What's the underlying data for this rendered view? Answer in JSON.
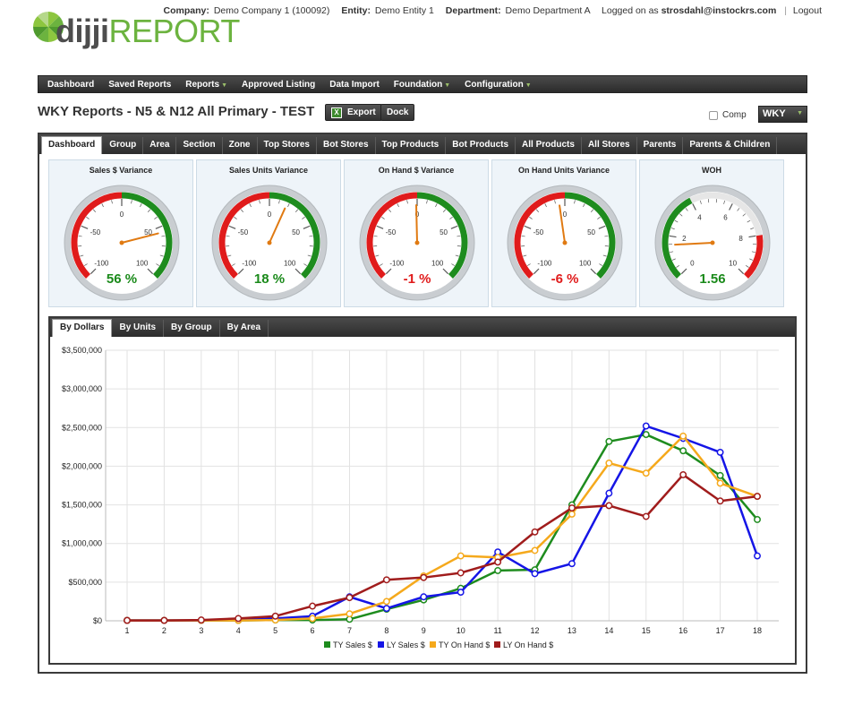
{
  "header": {
    "company_label": "Company:",
    "company_value": "Demo Company 1 (100092)",
    "entity_label": "Entity:",
    "entity_value": "Demo Entity 1",
    "department_label": "Department:",
    "department_value": "Demo Department A",
    "logged_in_prefix": "Logged on as",
    "logged_in_user": "strosdahl@instockrs.com",
    "separator": "|",
    "logout_label": "Logout"
  },
  "logo": {
    "part1": "dijji",
    "part2": "REPORT"
  },
  "nav": [
    {
      "label": "Dashboard",
      "dropdown": false
    },
    {
      "label": "Saved Reports",
      "dropdown": false
    },
    {
      "label": "Reports",
      "dropdown": true
    },
    {
      "label": "Approved Listing",
      "dropdown": false
    },
    {
      "label": "Data Import",
      "dropdown": false
    },
    {
      "label": "Foundation",
      "dropdown": true
    },
    {
      "label": "Configuration",
      "dropdown": true
    }
  ],
  "page": {
    "title": "WKY Reports - N5 & N12 All Primary - TEST",
    "export_label": "Export",
    "dock_label": "Dock",
    "comp_label": "Comp",
    "store_select_value": "WKY"
  },
  "tabs": [
    "Dashboard",
    "Group",
    "Area",
    "Section",
    "Zone",
    "Top Stores",
    "Bot Stores",
    "Top Products",
    "Bot Products",
    "All Products",
    "All Stores",
    "Parents",
    "Parents & Children"
  ],
  "gauges": [
    {
      "title": "Sales $ Variance",
      "value": 56,
      "display": "56 %",
      "color": "#1a8a1a",
      "kind": "variance",
      "ticks": [
        "-100",
        "-50",
        "0",
        "50",
        "100"
      ]
    },
    {
      "title": "Sales Units Variance",
      "value": 18,
      "display": "18 %",
      "color": "#1a8a1a",
      "kind": "variance",
      "ticks": [
        "-100",
        "-50",
        "0",
        "50",
        "100"
      ]
    },
    {
      "title": "On Hand $ Variance",
      "value": -1,
      "display": "-1 %",
      "color": "#e01b1b",
      "kind": "variance",
      "ticks": [
        "-100",
        "-50",
        "0",
        "50",
        "100"
      ]
    },
    {
      "title": "On Hand Units Variance",
      "value": -6,
      "display": "-6 %",
      "color": "#e01b1b",
      "kind": "variance",
      "ticks": [
        "-100",
        "-50",
        "0",
        "50",
        "100"
      ]
    },
    {
      "title": "WOH",
      "value": 1.56,
      "display": "1.56",
      "color": "#1a8a1a",
      "kind": "woh",
      "ticks": [
        "0",
        "2",
        "4",
        "6",
        "8",
        "10"
      ]
    }
  ],
  "chart_tabs": [
    "By Dollars",
    "By Units",
    "By Group",
    "By Area"
  ],
  "chart_data": {
    "type": "line",
    "x": [
      1,
      2,
      3,
      4,
      5,
      6,
      7,
      8,
      9,
      10,
      11,
      12,
      13,
      14,
      15,
      16,
      17,
      18
    ],
    "ylim": [
      0,
      3500000
    ],
    "yticks": [
      "$0",
      "$500,000",
      "$1,000,000",
      "$1,500,000",
      "$2,000,000",
      "$2,500,000",
      "$3,000,000",
      "$3,500,000"
    ],
    "ytick_values": [
      0,
      500000,
      1000000,
      1500000,
      2000000,
      2500000,
      3000000,
      3500000
    ],
    "series": [
      {
        "name": "TY Sales $",
        "color": "#1e8c1e",
        "values": [
          5000,
          5000,
          5000,
          5000,
          10000,
          10000,
          20000,
          150000,
          270000,
          420000,
          650000,
          660000,
          1500000,
          2320000,
          2410000,
          2200000,
          1880000,
          1310000
        ]
      },
      {
        "name": "LY Sales $",
        "color": "#1515e6",
        "values": [
          5000,
          5000,
          5000,
          10000,
          30000,
          60000,
          310000,
          160000,
          310000,
          370000,
          890000,
          610000,
          740000,
          1650000,
          2520000,
          2360000,
          2180000,
          840000
        ]
      },
      {
        "name": "TY On Hand $",
        "color": "#f5a91c",
        "values": [
          5000,
          5000,
          5000,
          5000,
          10000,
          30000,
          90000,
          250000,
          580000,
          840000,
          820000,
          910000,
          1380000,
          2040000,
          1910000,
          2390000,
          1780000,
          1610000
        ]
      },
      {
        "name": "LY On Hand $",
        "color": "#a01c1c",
        "values": [
          5000,
          5000,
          10000,
          30000,
          60000,
          190000,
          300000,
          530000,
          560000,
          620000,
          760000,
          1150000,
          1460000,
          1490000,
          1350000,
          1890000,
          1550000,
          1610000
        ]
      }
    ]
  }
}
